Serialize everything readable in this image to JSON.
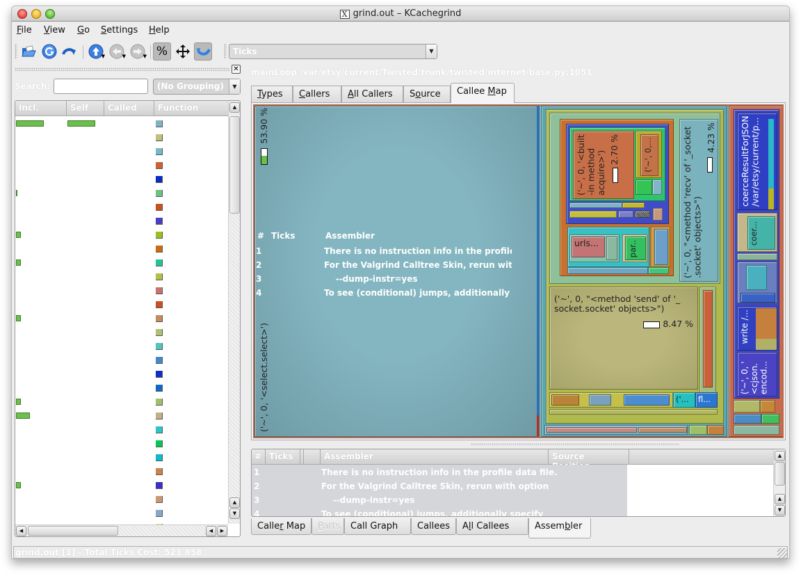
{
  "window": {
    "title": "grind.out – KCachegrind"
  },
  "menubar": {
    "items": [
      {
        "label": "File",
        "mnemonic": "F",
        "rest": "ile"
      },
      {
        "label": "View",
        "mnemonic": "V",
        "rest": "iew"
      },
      {
        "label": "Go",
        "mnemonic": "G",
        "rest": "o"
      },
      {
        "label": "Settings",
        "mnemonic": "S",
        "rest": "ettings"
      },
      {
        "label": "Help",
        "mnemonic": "H",
        "rest": "elp"
      }
    ]
  },
  "toolbar": {
    "buttons": [
      {
        "name": "open-file",
        "icon": "folder-open-icon"
      },
      {
        "name": "reload",
        "icon": "reload-icon"
      },
      {
        "name": "forward-cycle",
        "icon": "redo-arrow-icon"
      },
      {
        "name": "go-up",
        "icon": "arrow-up-circle-icon"
      },
      {
        "name": "go-back",
        "icon": "arrow-left-circle-icon"
      },
      {
        "name": "go-forward",
        "icon": "arrow-right-circle-icon"
      },
      {
        "name": "relative-percent",
        "icon": "percent-icon",
        "symbol": "%"
      },
      {
        "name": "move",
        "icon": "move-arrows-icon",
        "symbol": "✥"
      },
      {
        "name": "cycle-detection",
        "icon": "cycle-arrow-icon"
      }
    ],
    "event_type_combo": "Ticks"
  },
  "left_panel": {
    "search_label": "Search:",
    "search_value": "",
    "grouping_combo": "(No Grouping)",
    "columns": [
      "Incl.",
      "Self",
      "Called",
      "Function"
    ],
    "rows": [
      {
        "incl_bar": 0.54,
        "self_bar": 0.54,
        "color": "#7fb3c2"
      },
      {
        "incl_bar": 0,
        "self_bar": 0,
        "color": "#c2c07c"
      },
      {
        "incl_bar": 0,
        "self_bar": 0,
        "color": "#79b8c9"
      },
      {
        "incl_bar": 0,
        "self_bar": 0,
        "color": "#cc6233"
      },
      {
        "incl_bar": 0,
        "self_bar": 0,
        "color": "#0a2cc0"
      },
      {
        "incl_bar": 0.03,
        "self_bar": 0,
        "color": "#6cc281"
      },
      {
        "incl_bar": 0,
        "self_bar": 0,
        "color": "#c9511b"
      },
      {
        "incl_bar": 0,
        "self_bar": 0,
        "color": "#4a3fc2"
      },
      {
        "incl_bar": 0.09,
        "self_bar": 0,
        "color": "#98c21a"
      },
      {
        "incl_bar": 0,
        "self_bar": 0,
        "color": "#cc6a10"
      },
      {
        "incl_bar": 0.09,
        "self_bar": 0,
        "color": "#24c49a"
      },
      {
        "incl_bar": 0,
        "self_bar": 0,
        "color": "#b2c144"
      },
      {
        "incl_bar": 0,
        "self_bar": 0,
        "color": "#c97270"
      },
      {
        "incl_bar": 0,
        "self_bar": 0,
        "color": "#c9501f"
      },
      {
        "incl_bar": 0.09,
        "self_bar": 0,
        "color": "#c48a60"
      },
      {
        "incl_bar": 0,
        "self_bar": 0,
        "color": "#b0c070"
      },
      {
        "incl_bar": 0,
        "self_bar": 0,
        "color": "#52c4bf"
      },
      {
        "incl_bar": 0,
        "self_bar": 0,
        "color": "#4587c9"
      },
      {
        "incl_bar": 0,
        "self_bar": 0,
        "color": "#0f2ec4"
      },
      {
        "incl_bar": 0,
        "self_bar": 0,
        "color": "#0d6ac7"
      },
      {
        "incl_bar": 0.09,
        "self_bar": 0,
        "color": "#a2c06a"
      },
      {
        "incl_bar": 0.27,
        "self_bar": 0,
        "color": "#c4b084"
      },
      {
        "incl_bar": 0,
        "self_bar": 0,
        "color": "#2ec4c4"
      },
      {
        "incl_bar": 0,
        "self_bar": 0,
        "color": "#08c452"
      },
      {
        "incl_bar": 0,
        "self_bar": 0,
        "color": "#10b9c9"
      },
      {
        "incl_bar": 0,
        "self_bar": 0,
        "color": "#c9844e"
      },
      {
        "incl_bar": 0.09,
        "self_bar": 0,
        "color": "#3a2fc7"
      },
      {
        "incl_bar": 0,
        "self_bar": 0,
        "color": "#c99874"
      },
      {
        "incl_bar": 0,
        "self_bar": 0,
        "color": "#89a6c9"
      },
      {
        "incl_bar": 0,
        "self_bar": 0,
        "color": "#e7e07a"
      }
    ]
  },
  "main": {
    "function_title": "mainLoop /var/etsy/current/Twisted/trunk/twisted/internet/base.py:1051",
    "top_tabs": [
      {
        "label": "Types",
        "mn": "T",
        "rest": "ypes",
        "pre": ""
      },
      {
        "label": "Callers",
        "mn": "C",
        "rest": "allers",
        "pre": ""
      },
      {
        "label": "All Callers",
        "mn": "A",
        "rest": "ll Callers",
        "pre": ""
      },
      {
        "label": "Source",
        "pre": "S",
        "mn": "o",
        "rest": "urce"
      },
      {
        "label": "Callee Map",
        "pre": "Callee ",
        "mn": "M",
        "rest": "ap",
        "active": true
      }
    ],
    "callee_map": {
      "main_block": {
        "label": "('~', 0, '<select.select>')",
        "percent": "53.90 %",
        "percent_value": 53.9
      },
      "acquire_block": {
        "label_lines": [
          "('~', 0, '<built",
          "-in method",
          "acquire>')"
        ],
        "percent": "2.70 %",
        "percent_value": 2.7
      },
      "small_block_1": {
        "label": "('~', 0,..."
      },
      "recv_block": {
        "label_lines": [
          "('~', 0, \"<method 'recv' of '_socket",
          ".socket' objects>\")"
        ],
        "percent": "4.23 %",
        "percent_value": 4.23
      },
      "urls_block": {
        "label": "urls..."
      },
      "par_block": {
        "label": "par.."
      },
      "send_block": {
        "label_lines": [
          "('~', 0, \"<method 'send' of '_",
          "socket.socket' objects>\")"
        ],
        "percent": "8.47 %",
        "percent_value": 8.47
      },
      "tiny_block_1": {
        "label": "('..."
      },
      "tiny_block_2": {
        "label": "fl..."
      },
      "coerce_block": {
        "label_lines": [
          "coerceResultForJSON",
          "/var/etsy/current/p..."
        ]
      },
      "coer_block": {
        "label": "coer..."
      },
      "write_block": {
        "label": "write /..."
      },
      "cjson_block": {
        "label_lines": [
          "('~', 0, '",
          "<cjson.",
          "encod..."
        ]
      }
    },
    "assembler_overlay": {
      "header": [
        "#",
        "Ticks",
        "Assembler"
      ],
      "lines": [
        {
          "n": "1",
          "text": "There is no instruction info in the profile d"
        },
        {
          "n": "2",
          "text": "For the Valgrind Calltree Skin, rerun with o"
        },
        {
          "n": "3",
          "text": "    --dump-instr=yes"
        },
        {
          "n": "4",
          "text": "To see (conditional) jumps, additionally s"
        }
      ]
    }
  },
  "assembler_panel": {
    "columns": [
      "#",
      "Ticks",
      "",
      "Assembler",
      "Source Position"
    ],
    "rows": [
      {
        "n": "1",
        "text": "There is no instruction info in the profile data file."
      },
      {
        "n": "2",
        "text": "For the Valgrind Calltree Skin, rerun with option"
      },
      {
        "n": "3",
        "text": "    --dump-instr=yes"
      },
      {
        "n": "4",
        "text": "To see (conditional) jumps, additionally specify"
      }
    ]
  },
  "bottom_tabs": [
    {
      "label": "Caller Map",
      "pre": "Calle",
      "mn": "r",
      "rest": " Map"
    },
    {
      "label": "Parts",
      "pre": "",
      "mn": "P",
      "rest": "arts",
      "disabled": true
    },
    {
      "label": "Call Graph",
      "pre": "Call Graph",
      "mn": "",
      "rest": ""
    },
    {
      "label": "Callees",
      "pre": "Callees",
      "mn": "",
      "rest": ""
    },
    {
      "label": "All Callees",
      "pre": "A",
      "mn": "l",
      "rest": "l Callees"
    },
    {
      "label": "Assembler",
      "pre": "Assem",
      "mn": "b",
      "rest": "ler",
      "active": true
    }
  ],
  "statusbar": {
    "text": "grind.out [1] - Total Ticks Cost:  521 858"
  }
}
